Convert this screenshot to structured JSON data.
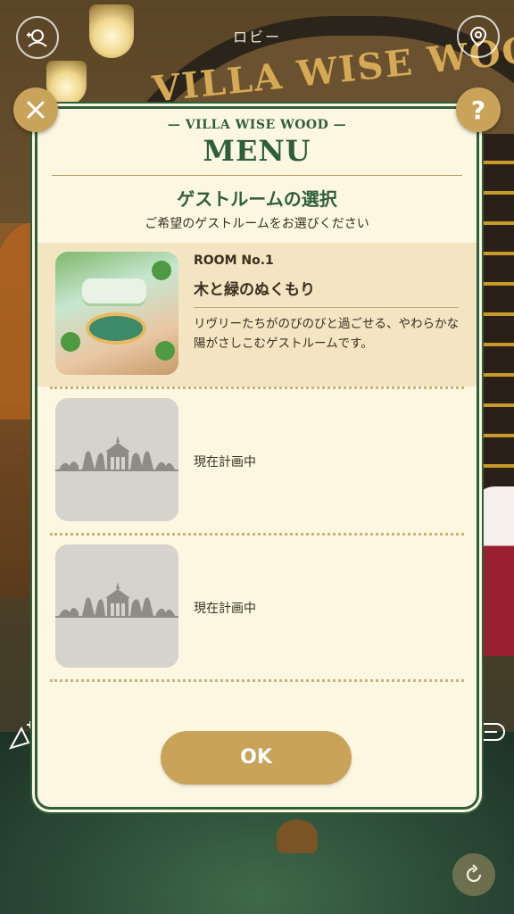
{
  "scene": {
    "lobby_label": "ロビー",
    "arch_title": "VILLA WISE WOO",
    "icons": [
      "friends-icon",
      "location-pin-icon",
      "wand-icon",
      "chat-icon",
      "refresh-icon"
    ]
  },
  "header_buttons": {
    "close_icon": "close-icon",
    "help_glyph": "?"
  },
  "modal": {
    "brand": "— VILLA WISE WOOD —",
    "title": "MENU",
    "section_title": "ゲストルームの選択",
    "section_subtitle": "ご希望のゲストルームをお選びください",
    "rooms": [
      {
        "number": "ROOM No.1",
        "name": "木と緑のぬくもり",
        "description": "リヴリーたちがのびのびと過ごせる、やわらかな陽がさしこむゲストルームです。",
        "selected": true
      },
      {
        "status": "現在計画中"
      },
      {
        "status": "現在計画中"
      }
    ],
    "ok_label": "OK"
  },
  "colors": {
    "accent_green": "#2f5f3a",
    "gold": "#c9a35a",
    "panel_bg": "#fdf7e2",
    "selected_bg": "#f3e4c2"
  }
}
